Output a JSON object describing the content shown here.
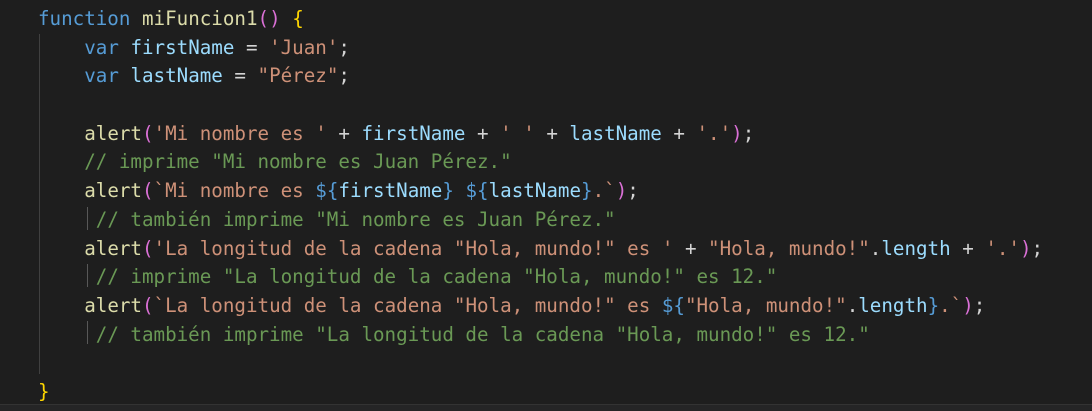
{
  "editor": {
    "lines": [
      [
        {
          "t": "function",
          "c": "kw"
        },
        {
          "t": " ",
          "c": "punc"
        },
        {
          "t": "miFuncion1",
          "c": "fn"
        },
        {
          "t": "()",
          "c": "brace-pink"
        },
        {
          "t": " ",
          "c": "punc"
        },
        {
          "t": "{",
          "c": "brace-gold"
        }
      ],
      [
        {
          "t": "    ",
          "c": "punc"
        },
        {
          "t": "var",
          "c": "kw"
        },
        {
          "t": " ",
          "c": "punc"
        },
        {
          "t": "firstName",
          "c": "var"
        },
        {
          "t": " = ",
          "c": "punc"
        },
        {
          "t": "'Juan'",
          "c": "str"
        },
        {
          "t": ";",
          "c": "punc"
        }
      ],
      [
        {
          "t": "    ",
          "c": "punc"
        },
        {
          "t": "var",
          "c": "kw"
        },
        {
          "t": " ",
          "c": "punc"
        },
        {
          "t": "lastName",
          "c": "var"
        },
        {
          "t": " = ",
          "c": "punc"
        },
        {
          "t": "\"Pérez\"",
          "c": "str"
        },
        {
          "t": ";",
          "c": "punc"
        }
      ],
      [],
      [
        {
          "t": "    ",
          "c": "punc"
        },
        {
          "t": "alert",
          "c": "fn"
        },
        {
          "t": "(",
          "c": "brace-pink"
        },
        {
          "t": "'Mi nombre es '",
          "c": "str"
        },
        {
          "t": " + ",
          "c": "punc"
        },
        {
          "t": "firstName",
          "c": "var"
        },
        {
          "t": " + ",
          "c": "punc"
        },
        {
          "t": "' '",
          "c": "str"
        },
        {
          "t": " + ",
          "c": "punc"
        },
        {
          "t": "lastName",
          "c": "var"
        },
        {
          "t": " + ",
          "c": "punc"
        },
        {
          "t": "'.'",
          "c": "str"
        },
        {
          "t": ")",
          "c": "brace-pink"
        },
        {
          "t": ";",
          "c": "punc"
        }
      ],
      [
        {
          "t": "    ",
          "c": "punc"
        },
        {
          "t": "// imprime \"Mi nombre es Juan Pérez.\"",
          "c": "cmt"
        }
      ],
      [
        {
          "t": "    ",
          "c": "punc"
        },
        {
          "t": "alert",
          "c": "fn"
        },
        {
          "t": "(",
          "c": "brace-pink"
        },
        {
          "t": "`Mi nombre es ",
          "c": "str"
        },
        {
          "t": "${",
          "c": "tpl-op"
        },
        {
          "t": "firstName",
          "c": "var"
        },
        {
          "t": "}",
          "c": "tpl-op"
        },
        {
          "t": " ",
          "c": "str"
        },
        {
          "t": "${",
          "c": "tpl-op"
        },
        {
          "t": "lastName",
          "c": "var"
        },
        {
          "t": "}",
          "c": "tpl-op"
        },
        {
          "t": ".`",
          "c": "str"
        },
        {
          "t": ")",
          "c": "brace-pink"
        },
        {
          "t": ";",
          "c": "punc"
        }
      ],
      [
        {
          "t": "     ",
          "c": "punc"
        },
        {
          "t": "// también imprime \"Mi nombre es Juan Pérez.\"",
          "c": "cmt"
        }
      ],
      [
        {
          "t": "    ",
          "c": "punc"
        },
        {
          "t": "alert",
          "c": "fn"
        },
        {
          "t": "(",
          "c": "brace-pink"
        },
        {
          "t": "'La longitud de la cadena \"Hola, mundo!\" es '",
          "c": "str"
        },
        {
          "t": " + ",
          "c": "punc"
        },
        {
          "t": "\"Hola, mundo!\"",
          "c": "str"
        },
        {
          "t": ".",
          "c": "punc"
        },
        {
          "t": "length",
          "c": "var"
        },
        {
          "t": " + ",
          "c": "punc"
        },
        {
          "t": "'.'",
          "c": "str"
        },
        {
          "t": ")",
          "c": "brace-pink"
        },
        {
          "t": ";",
          "c": "punc"
        }
      ],
      [
        {
          "t": "     ",
          "c": "punc"
        },
        {
          "t": "// imprime \"La longitud de la cadena \"Hola, mundo!\" es 12.\"",
          "c": "cmt"
        }
      ],
      [
        {
          "t": "    ",
          "c": "punc"
        },
        {
          "t": "alert",
          "c": "fn"
        },
        {
          "t": "(",
          "c": "brace-pink"
        },
        {
          "t": "`La longitud de la cadena \"Hola, mundo!\" es ",
          "c": "str"
        },
        {
          "t": "${",
          "c": "tpl-op"
        },
        {
          "t": "\"Hola, mundo!\"",
          "c": "str"
        },
        {
          "t": ".",
          "c": "punc"
        },
        {
          "t": "length",
          "c": "var"
        },
        {
          "t": "}",
          "c": "tpl-op"
        },
        {
          "t": ".`",
          "c": "str"
        },
        {
          "t": ")",
          "c": "brace-pink"
        },
        {
          "t": ";",
          "c": "punc"
        }
      ],
      [
        {
          "t": "     ",
          "c": "punc"
        },
        {
          "t": "// también imprime \"La longitud de la cadena \"Hola, mundo!\" es 12.\"",
          "c": "cmt"
        }
      ],
      [],
      [
        {
          "t": "}",
          "c": "brace-gold"
        }
      ]
    ]
  },
  "colors": {
    "background": "#1e1e1e",
    "keyword": "#569cd6",
    "function": "#dcdcaa",
    "variable": "#9cdcfe",
    "string": "#ce9178",
    "comment": "#6a9955",
    "bracket_gold": "#ffd700",
    "bracket_pink": "#da70d6"
  }
}
